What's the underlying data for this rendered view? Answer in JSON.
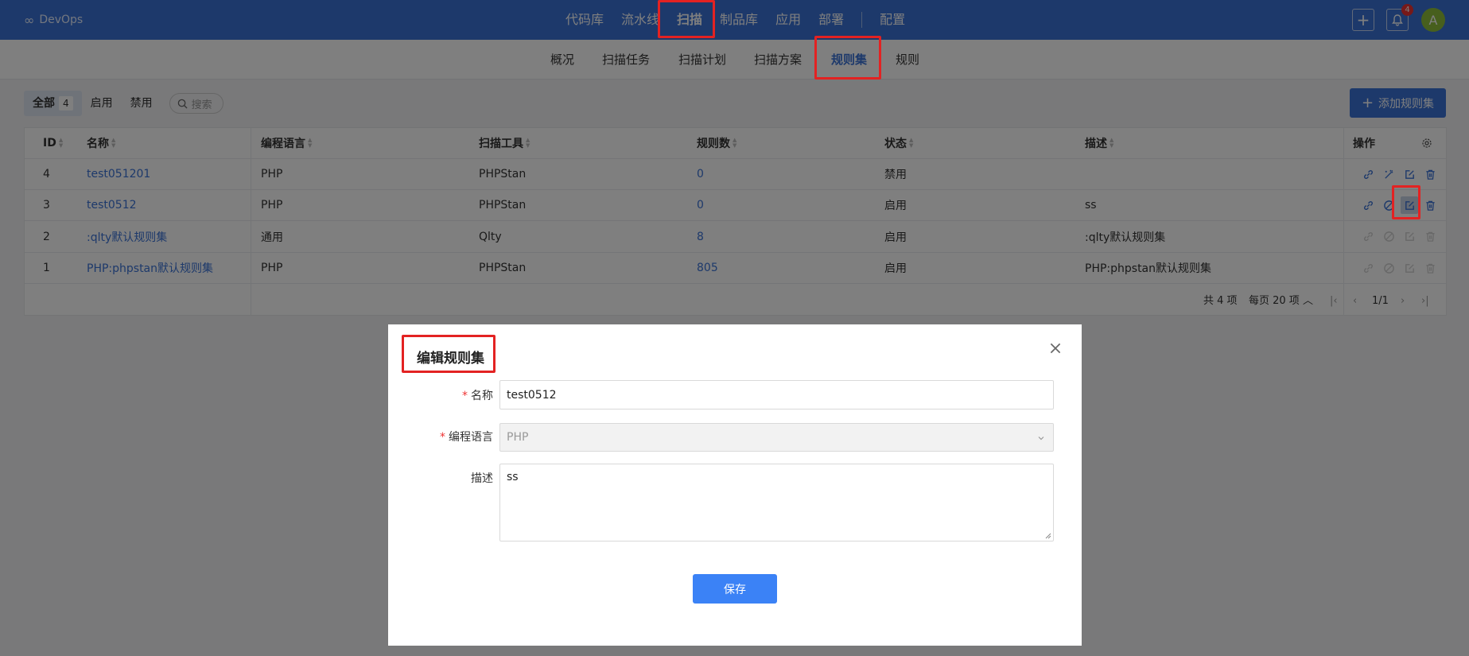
{
  "app": {
    "logo_symbol": "∞",
    "name": "DevOps"
  },
  "top_menu": [
    "代码库",
    "流水线",
    "扫描",
    "制品库",
    "应用",
    "部署",
    "配置"
  ],
  "notifications": {
    "count": "4"
  },
  "user": {
    "initial": "A"
  },
  "sub_tabs": [
    "概况",
    "扫描任务",
    "扫描计划",
    "扫描方案",
    "规则集",
    "规则"
  ],
  "filters": {
    "all": "全部",
    "all_count": "4",
    "enabled": "启用",
    "disabled": "禁用",
    "search_placeholder": "搜索"
  },
  "add_button": "添加规则集",
  "table": {
    "headers": {
      "id": "ID",
      "name": "名称",
      "language": "编程语言",
      "tool": "扫描工具",
      "rule_count": "规则数",
      "status": "状态",
      "description": "描述",
      "actions": "操作"
    },
    "rows": [
      {
        "id": "4",
        "name": "test051201",
        "language": "PHP",
        "tool": "PHPStan",
        "rule_count": "0",
        "status": "禁用",
        "description": ""
      },
      {
        "id": "3",
        "name": "test0512",
        "language": "PHP",
        "tool": "PHPStan",
        "rule_count": "0",
        "status": "启用",
        "description": "ss"
      },
      {
        "id": "2",
        "name": ":qlty默认规则集",
        "language": "通用",
        "tool": "Qlty",
        "rule_count": "8",
        "status": "启用",
        "description": ":qlty默认规则集"
      },
      {
        "id": "1",
        "name": "PHP:phpstan默认规则集",
        "language": "PHP",
        "tool": "PHPStan",
        "rule_count": "805",
        "status": "启用",
        "description": "PHP:phpstan默认规则集"
      }
    ]
  },
  "pagination": {
    "total": "共 4 项",
    "per_page": "每页 20 项",
    "page": "1/1"
  },
  "modal": {
    "title": "编辑规则集",
    "name_label": "名称",
    "name_value": "test0512",
    "language_label": "编程语言",
    "language_value": "PHP",
    "description_label": "描述",
    "description_value": "ss",
    "save": "保存"
  },
  "colors": {
    "primary": "#3b73d6",
    "highlight": "#e32222"
  }
}
